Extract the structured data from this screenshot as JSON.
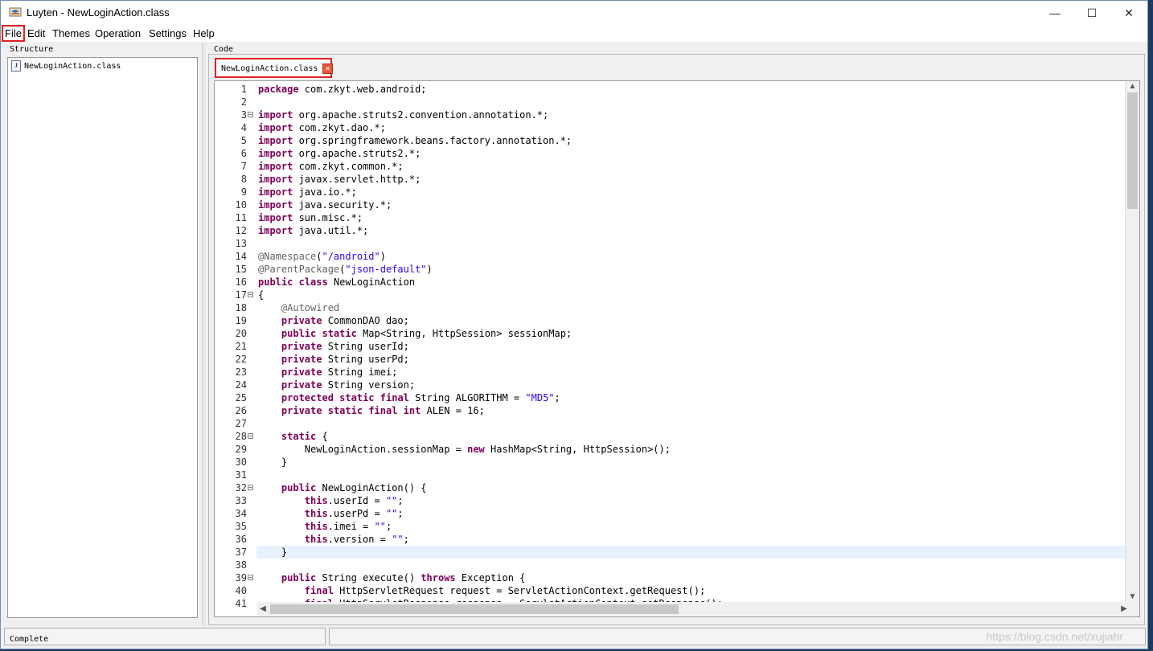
{
  "window": {
    "title": "Luyten - NewLoginAction.class",
    "controls": {
      "minimize": "—",
      "maximize": "☐",
      "close": "✕"
    }
  },
  "menu": [
    "File",
    "Edit",
    "Themes",
    "Operation",
    "Settings",
    "Help"
  ],
  "structure": {
    "label": "Structure",
    "items": [
      "NewLoginAction.class"
    ]
  },
  "code_panel": {
    "label": "Code"
  },
  "tab": {
    "label": "NewLoginAction.class",
    "close": "✕"
  },
  "code": {
    "lines": [
      {
        "n": "1",
        "t": "package com.zkyt.web.android;"
      },
      {
        "n": "2",
        "t": ""
      },
      {
        "n": "3",
        "t": "import org.apache.struts2.convention.annotation.*;",
        "fold": true
      },
      {
        "n": "4",
        "t": "import com.zkyt.dao.*;"
      },
      {
        "n": "5",
        "t": "import org.springframework.beans.factory.annotation.*;"
      },
      {
        "n": "6",
        "t": "import org.apache.struts2.*;"
      },
      {
        "n": "7",
        "t": "import com.zkyt.common.*;"
      },
      {
        "n": "8",
        "t": "import javax.servlet.http.*;"
      },
      {
        "n": "9",
        "t": "import java.io.*;"
      },
      {
        "n": "10",
        "t": "import java.security.*;"
      },
      {
        "n": "11",
        "t": "import sun.misc.*;"
      },
      {
        "n": "12",
        "t": "import java.util.*;"
      },
      {
        "n": "13",
        "t": ""
      },
      {
        "n": "14",
        "t": "@Namespace(\"/android\")"
      },
      {
        "n": "15",
        "t": "@ParentPackage(\"json-default\")"
      },
      {
        "n": "16",
        "t": "public class NewLoginAction"
      },
      {
        "n": "17",
        "t": "{",
        "fold": true
      },
      {
        "n": "18",
        "t": "    @Autowired"
      },
      {
        "n": "19",
        "t": "    private CommonDAO dao;"
      },
      {
        "n": "20",
        "t": "    public static Map<String, HttpSession> sessionMap;"
      },
      {
        "n": "21",
        "t": "    private String userId;"
      },
      {
        "n": "22",
        "t": "    private String userPd;"
      },
      {
        "n": "23",
        "t": "    private String imei;"
      },
      {
        "n": "24",
        "t": "    private String version;"
      },
      {
        "n": "25",
        "t": "    protected static final String ALGORITHM = \"MD5\";"
      },
      {
        "n": "26",
        "t": "    private static final int ALEN = 16;"
      },
      {
        "n": "27",
        "t": ""
      },
      {
        "n": "28",
        "t": "    static {",
        "fold": true
      },
      {
        "n": "29",
        "t": "        NewLoginAction.sessionMap = new HashMap<String, HttpSession>();"
      },
      {
        "n": "30",
        "t": "    }"
      },
      {
        "n": "31",
        "t": ""
      },
      {
        "n": "32",
        "t": "    public NewLoginAction() {",
        "fold": true
      },
      {
        "n": "33",
        "t": "        this.userId = \"\";"
      },
      {
        "n": "34",
        "t": "        this.userPd = \"\";"
      },
      {
        "n": "35",
        "t": "        this.imei = \"\";"
      },
      {
        "n": "36",
        "t": "        this.version = \"\";"
      },
      {
        "n": "37",
        "t": "    }",
        "current": true
      },
      {
        "n": "38",
        "t": ""
      },
      {
        "n": "39",
        "t": "    public String execute() throws Exception {",
        "fold": true
      },
      {
        "n": "40",
        "t": "        final HttpServletRequest request = ServletActionContext.getRequest();"
      },
      {
        "n": "41",
        "t": "        final HttpServletResponse response = ServletActionContext.getResponse();"
      }
    ]
  },
  "status": {
    "text": "Complete"
  },
  "watermark": "https://blog.csdn.net/xujiahr",
  "colors": {
    "keyword": "#7f0055",
    "string": "#2a00ff",
    "annotation": "#646464",
    "highlight": "#e02020",
    "current_line": "#e8f2fe"
  },
  "icons": {
    "app": "luyten-app-icon",
    "file": "java-file-icon",
    "fold": "fold-minus-icon"
  }
}
